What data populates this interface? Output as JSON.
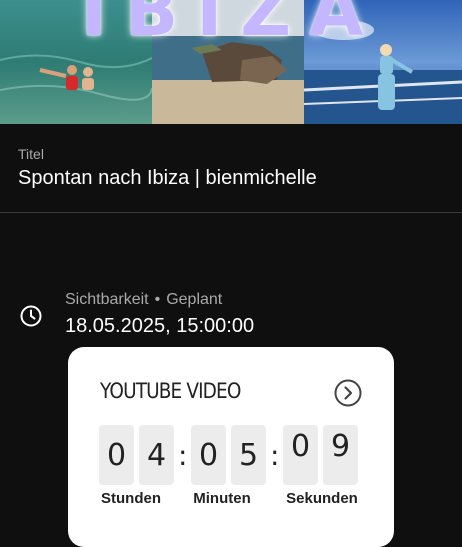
{
  "thumbnail": {
    "title_text": "IBIZA"
  },
  "details": {
    "title_label": "Titel",
    "title_value": "Spontan nach Ibiza | bienmichelle",
    "visibility_label": "Sichtbarkeit",
    "separator": "•",
    "visibility_value": "Geplant",
    "scheduled_datetime": "18.05.2025, 15:00:00"
  },
  "countdown": {
    "card_title": "YOUTUBE VIDEO",
    "hours_digits": [
      "0",
      "4"
    ],
    "minutes_digits": [
      "0",
      "5"
    ],
    "seconds_digits": [
      "0",
      "9"
    ],
    "colon": ":",
    "hours_label": "Stunden",
    "minutes_label": "Minuten",
    "seconds_label": "Sekunden"
  },
  "icons": {
    "schedule": "clock-icon",
    "card_action": "chevron-right-circle-icon"
  },
  "colors": {
    "background": "#0f0f0f",
    "card": "#ffffff",
    "secondary_text": "#aaaaaa",
    "thumbnail_title": "#c4b7ff"
  }
}
